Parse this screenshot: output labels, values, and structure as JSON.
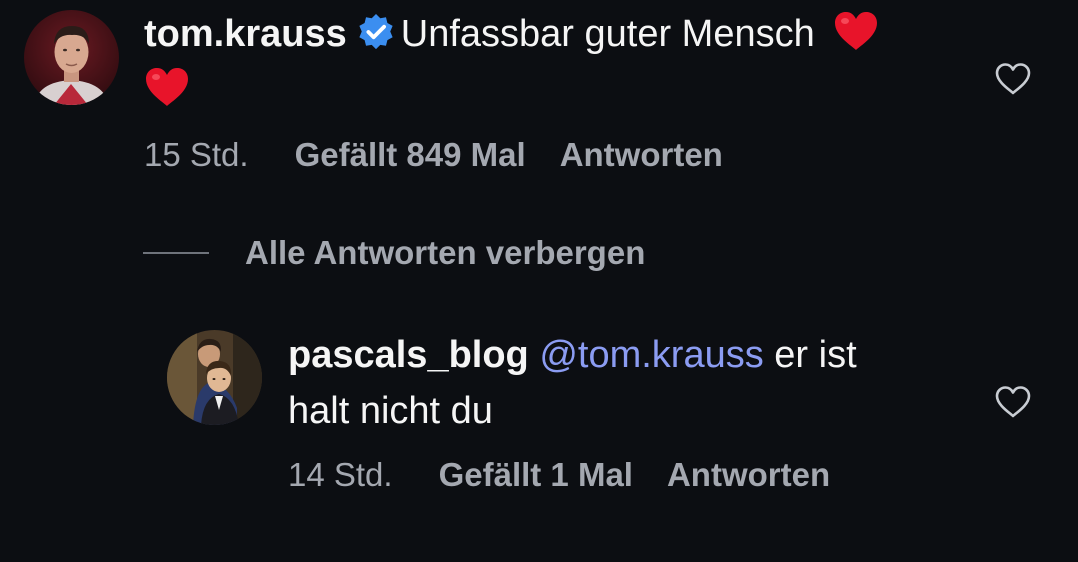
{
  "main_comment": {
    "username": "tom.krauss",
    "verified": true,
    "text": "Unfassbar guter Mensch",
    "emoji": [
      "heart-emoji",
      "heart-emoji"
    ],
    "time": "15 Std.",
    "likes": "Gefällt 849 Mal",
    "reply_label": "Antworten"
  },
  "hide_replies_label": "Alle Antworten verbergen",
  "reply_comment": {
    "username": "pascals_blog",
    "mention": "@tom.krauss",
    "text_line1": "er ist",
    "text_line2": "halt nicht du",
    "time": "14 Std.",
    "likes": "Gefällt 1 Mal",
    "reply_label": "Antworten"
  },
  "colors": {
    "background": "#0c0e12",
    "text_primary": "#f5f5f5",
    "text_secondary": "#a4a8b0",
    "mention": "#8b9cf2",
    "verified_badge": "#3b8ef0",
    "heart_emoji": "#e8142a"
  }
}
